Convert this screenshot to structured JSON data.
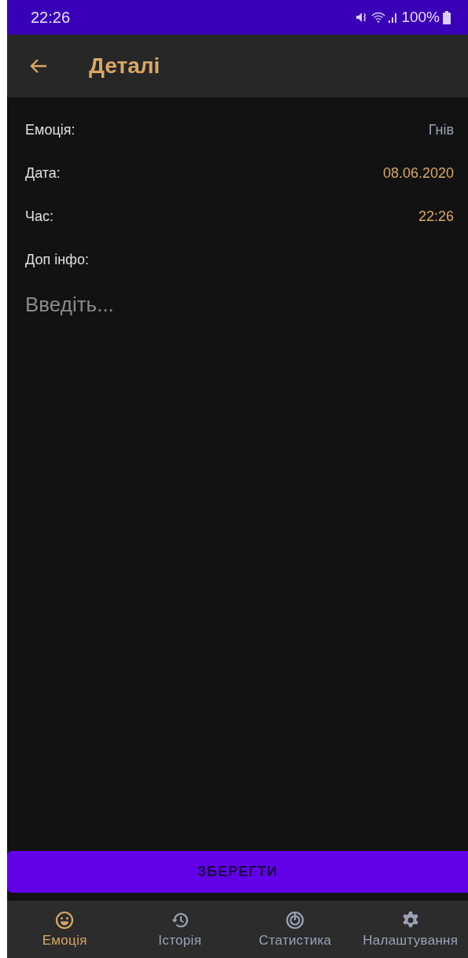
{
  "status_bar": {
    "time": "22:26",
    "battery": "100%"
  },
  "toolbar": {
    "title": "Деталі"
  },
  "fields": [
    {
      "label": "Емоція:",
      "value": "Гнів",
      "color": "#9aa3b5"
    },
    {
      "label": "Дата:",
      "value": "08.06.2020",
      "color": "#d9a866"
    },
    {
      "label": "Час:",
      "value": "22:26",
      "color": "#d9a866"
    },
    {
      "label": "Доп інфо:"
    }
  ],
  "note": {
    "placeholder": "Введіть..."
  },
  "save_button": "ЗБЕРЕГТИ",
  "bottom_nav": [
    {
      "label": "Емоція",
      "selected": true
    },
    {
      "label": "Історія",
      "selected": false
    },
    {
      "label": "Статистика",
      "selected": false
    },
    {
      "label": "Налаштування",
      "selected": false
    }
  ]
}
